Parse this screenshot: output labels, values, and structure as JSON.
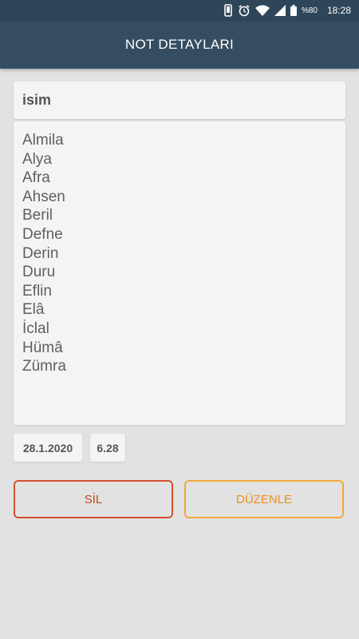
{
  "status_bar": {
    "battery_text": "%80",
    "time": "18:28",
    "icons": [
      "phone-vibrate-icon",
      "alarm-icon",
      "wifi-icon",
      "signal-icon",
      "battery-icon"
    ]
  },
  "app_bar": {
    "title": "NOT DETAYLARI"
  },
  "note": {
    "title": "isim",
    "lines": [
      "Almila",
      "Alya",
      "Afra",
      "Ahsen",
      "Beril",
      "Defne",
      "Derin",
      "Duru",
      "Eflin",
      "Elâ",
      "İclal",
      "Hümâ",
      "Zümra"
    ],
    "date": "28.1.2020",
    "time": "6.28"
  },
  "actions": {
    "delete_label": "SİL",
    "edit_label": "DÜZENLE"
  },
  "colors": {
    "app_bar": "#344d61",
    "status_bar": "#2e4659",
    "background": "#e2e2e2",
    "card": "#f4f4f4",
    "delete_accent": "#d4512e",
    "edit_accent": "#f0a83a"
  }
}
